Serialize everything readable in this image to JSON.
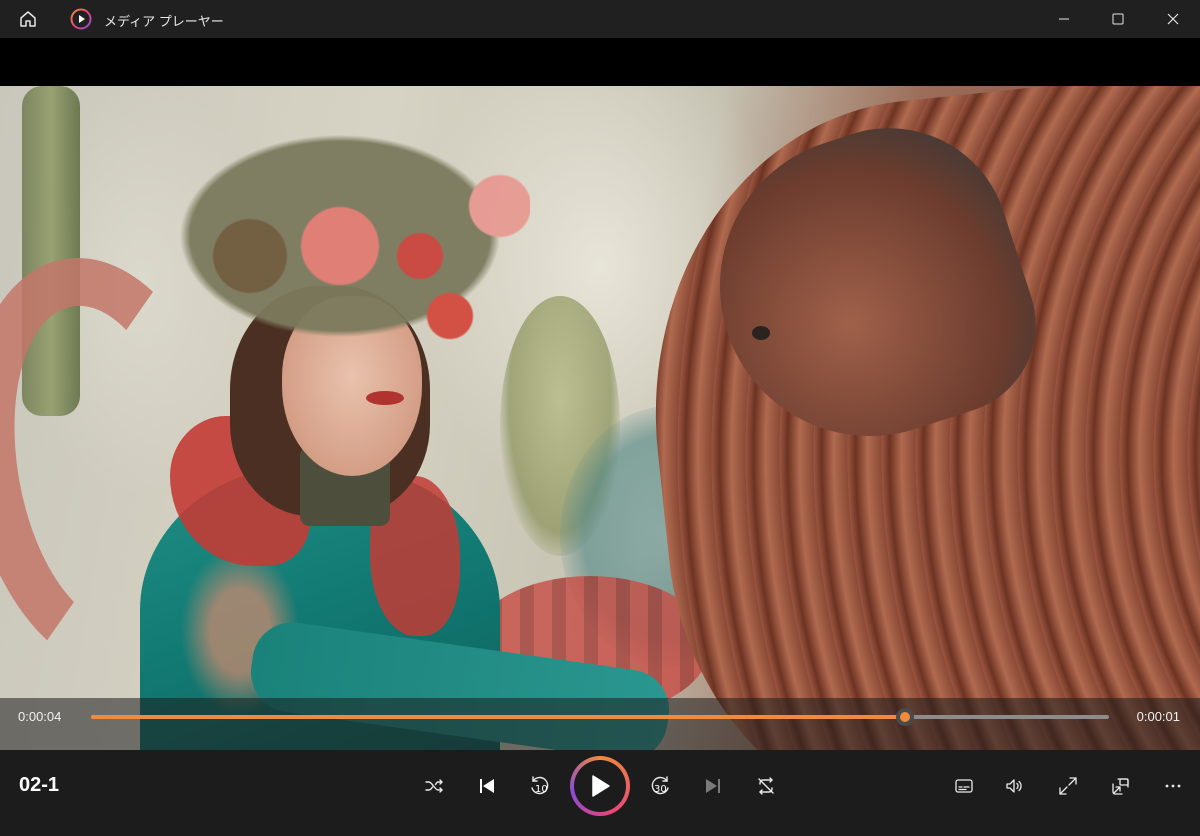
{
  "window": {
    "title": "メディア プレーヤー"
  },
  "player": {
    "current_time": "0:00:04",
    "remaining_time": "0:00:01",
    "progress": 0.8,
    "media_title": "02-1"
  },
  "controls": {
    "skip_back_seconds": "10",
    "skip_forward_seconds": "30"
  },
  "colors": {
    "accent": "#f08a3c",
    "titlebar": "#202020",
    "controlbar": "#1c1c1c"
  }
}
